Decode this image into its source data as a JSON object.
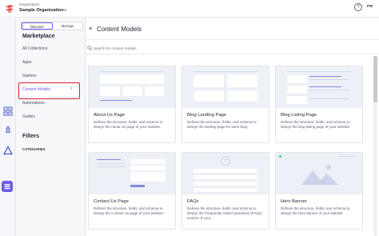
{
  "header": {
    "org_label": "Organization",
    "org_name": "Sample Organization",
    "help_icon": "question-circle-icon",
    "user_initials": "PW"
  },
  "rail": {
    "icons": [
      "apps-grid-icon",
      "rocket-icon",
      "triangle-logo-icon",
      "content-models-icon"
    ],
    "active": "content-models-icon",
    "accent": "#6c5ce7"
  },
  "sidebar": {
    "tabs": [
      "Discover",
      "Manage"
    ],
    "active_tab": "Discover",
    "marketplace_heading": "Marketplace",
    "items": [
      "All Collections",
      "Apps",
      "Starters",
      "Content Models",
      "Automations",
      "Guides"
    ],
    "selected_item": "Content Models",
    "filters_heading": "Filters",
    "categories_label": "CATEGORIES",
    "highlight_color": "#e1232d"
  },
  "main": {
    "title": "Content Models",
    "search_placeholder": "Search for content models",
    "cards": [
      {
        "title": "About Us Page",
        "description": "Defines the structure, fields, and schema to design the About Us page of your website."
      },
      {
        "title": "Blog Landing Page",
        "description": "Defines the structure, fields, and schema to design the landing page for each blog."
      },
      {
        "title": "Blog Listing Page",
        "description": "Defines the structure, fields, and schema to design the blog listing page of your website."
      },
      {
        "title": "Contact Us Page",
        "description": "Defines the structure, fields, and schema to design the Contact Us page of your website."
      },
      {
        "title": "FAQs",
        "description": "Defines the structure, fields, and schema to design the Frequently Asked Questions (FAQs) section of your..."
      },
      {
        "title": "Hero Banner",
        "description": "Defines the structure, fields, and schema to design the hero banner of your website."
      }
    ]
  }
}
